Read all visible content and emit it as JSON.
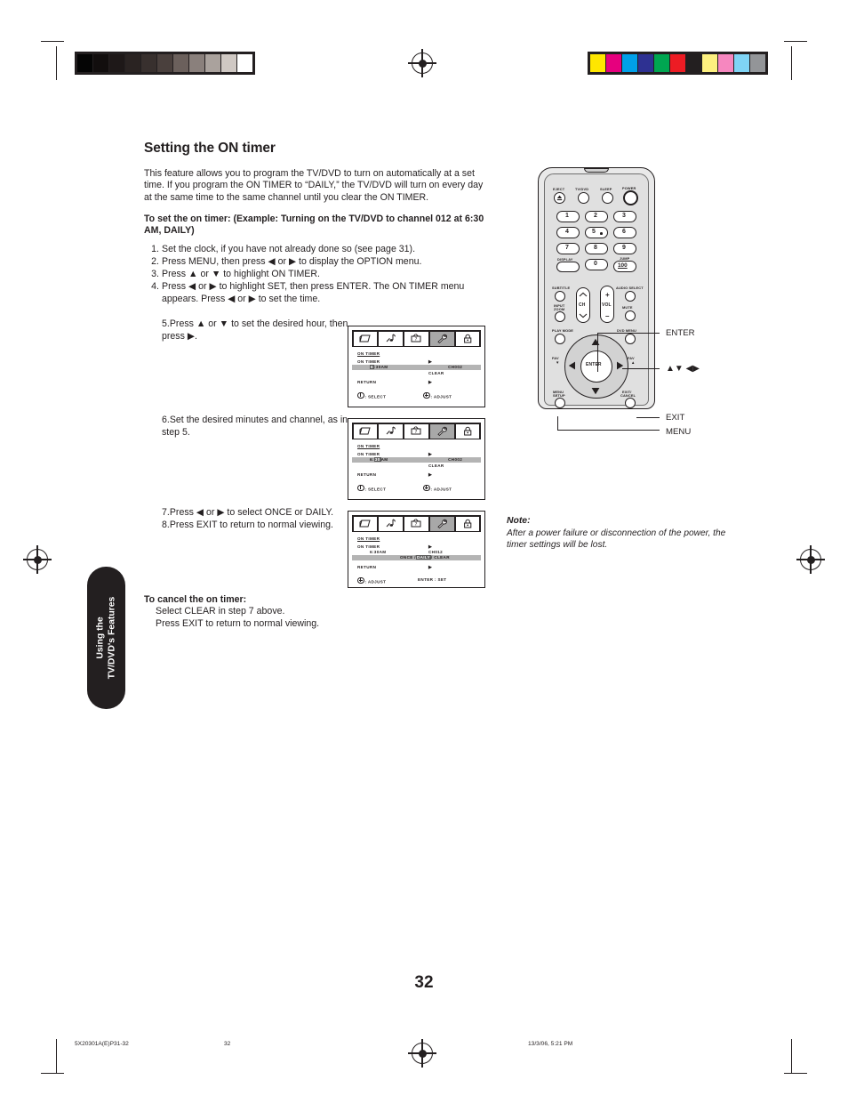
{
  "document": {
    "page_number": "32",
    "section_tab": "Using the\nTV/DVD's Features",
    "section_tab_line1": "Using the",
    "section_tab_line2": "TV/DVD's Features"
  },
  "content": {
    "title": "Setting the ON timer",
    "intro": "This feature allows you to program the TV/DVD to turn on automatically at a set time. If you program the ON TIMER to “DAILY,” the TV/DVD will turn on every day at the same time to the same channel until you clear the ON TIMER.",
    "subheading": "To set the on timer: (Example: Turning on the TV/DVD to channel 012 at 6:30 AM, DAILY)",
    "steps": [
      {
        "num": "1.",
        "text": "Set the clock, if you have not already done so (see page 31)."
      },
      {
        "num": "2.",
        "text": "Press MENU, then press ◀ or ▶ to display the OPTION menu."
      },
      {
        "num": "3.",
        "text": "Press ▲ or ▼ to highlight ON TIMER."
      },
      {
        "num": "4.",
        "text": "Press ◀ or ▶ to highlight SET, then press ENTER. The ON TIMER menu appears. Press ◀ or ▶ to set the time."
      },
      {
        "num": "5.",
        "text": "Press ▲ or ▼ to set the desired hour, then press ▶."
      },
      {
        "num": "6.",
        "text": "Set the desired minutes and channel, as in step 5."
      },
      {
        "num": "7.",
        "text": "Press ◀ or ▶ to select ONCE or DAILY."
      },
      {
        "num": "8.",
        "text": "Press EXIT to return to normal viewing."
      }
    ],
    "cancel": {
      "heading": "To cancel the on timer:",
      "line1": "Select CLEAR in step 7 above.",
      "line2": "Press EXIT to return to normal viewing."
    },
    "note": {
      "heading": "Note:",
      "body": "After a power failure or disconnection of the power, the timer settings will be lost."
    }
  },
  "osd_screens": [
    {
      "id": "osd-step5",
      "icons": [
        "picture-icon",
        "audio-icon",
        "tv-setup-icon",
        "wrench-icon",
        "lock-icon"
      ],
      "selected_icon_index": 3,
      "header": "ON TIMER",
      "label": "ON TIMER",
      "time": "6:30AM",
      "time_selected_part": "6",
      "time_rest": ":30AM",
      "channel": "CH002",
      "clear": "CLEAR",
      "return": "RETURN",
      "indicator": "▶",
      "footer_left": ": SELECT",
      "footer_right": ": ADJUST"
    },
    {
      "id": "osd-step6",
      "icons": [
        "picture-icon",
        "audio-icon",
        "tv-setup-icon",
        "wrench-icon",
        "lock-icon"
      ],
      "selected_icon_index": 3,
      "header": "ON TIMER",
      "label": "ON TIMER",
      "time": "6:30AM",
      "time_selected_part": "30",
      "time_rest": "AM",
      "time_prefix": "6:",
      "channel": "CH002",
      "clear": "CLEAR",
      "return": "RETURN",
      "indicator": "▶",
      "footer_left": ": SELECT",
      "footer_right": ": ADJUST"
    },
    {
      "id": "osd-step7",
      "icons": [
        "picture-icon",
        "audio-icon",
        "tv-setup-icon",
        "wrench-icon",
        "lock-icon"
      ],
      "selected_icon_index": 3,
      "header": "ON TIMER",
      "label": "ON TIMER",
      "time": "6:30AM",
      "channel": "CH012",
      "mode_once": "ONCE /",
      "mode_daily": "DAILY",
      "mode_clear": "/ CLEAR",
      "return": "RETURN",
      "indicator": "▶",
      "footer_left": ": ADJUST",
      "footer_right": "ENTER : SET"
    }
  ],
  "remote": {
    "buttons": [
      {
        "label": "EJECT",
        "name": "eject-button"
      },
      {
        "label": "TV/DVD",
        "name": "tv-dvd-button"
      },
      {
        "label": "SLEEP",
        "name": "sleep-button"
      },
      {
        "label": "POWER",
        "name": "power-button"
      },
      {
        "label": "1",
        "name": "digit-1-button"
      },
      {
        "label": "2",
        "name": "digit-2-button"
      },
      {
        "label": "3",
        "name": "digit-3-button"
      },
      {
        "label": "4",
        "name": "digit-4-button"
      },
      {
        "label": "5",
        "name": "digit-5-button"
      },
      {
        "label": "6",
        "name": "digit-6-button"
      },
      {
        "label": "7",
        "name": "digit-7-button"
      },
      {
        "label": "8",
        "name": "digit-8-button"
      },
      {
        "label": "9",
        "name": "digit-9-button"
      },
      {
        "label": "0",
        "name": "digit-0-button"
      },
      {
        "label": "DISPLAY",
        "name": "display-button"
      },
      {
        "label": "JUMP",
        "name": "jump-button"
      },
      {
        "label": "100",
        "name": "hundred-button"
      },
      {
        "label": "SUBTITLE",
        "name": "subtitle-button"
      },
      {
        "label": "AUDIO SELECT",
        "name": "audio-select-button"
      },
      {
        "label": "INPUT",
        "name": "input-zoom-button"
      },
      {
        "label": "ZOOM",
        "name": "input-zoom-button-2"
      },
      {
        "label": "CH",
        "name": "channel-rocker"
      },
      {
        "label": "VOL",
        "name": "volume-rocker"
      },
      {
        "label": "MUTE",
        "name": "mute-button"
      },
      {
        "label": "PLAY MODE",
        "name": "play-mode-button"
      },
      {
        "label": "DVD MENU",
        "name": "dvd-menu-button"
      },
      {
        "label": "ENTER",
        "name": "enter-button"
      },
      {
        "label": "FAV",
        "name": "fav-down-button"
      },
      {
        "label": "FAV",
        "name": "fav-up-button"
      },
      {
        "label": "MENU",
        "name": "menu-setup-button"
      },
      {
        "label": "SETUP",
        "name": "menu-setup-button-2"
      },
      {
        "label": "EXIT/",
        "name": "exit-cancel-button"
      },
      {
        "label": "CANCEL",
        "name": "exit-cancel-button-2"
      }
    ],
    "labels": {
      "eject": "EJECT",
      "tvdvd": "TV/DVD",
      "sleep": "SLEEP",
      "power": "POWER",
      "display": "DISPLAY",
      "jump": "JUMP",
      "hundred": "100",
      "subtitle": "SUBTITLE",
      "audio_select": "AUDIO SELECT",
      "input": "INPUT",
      "zoom": "ZOOM",
      "ch": "CH",
      "vol": "VOL",
      "vol_plus": "+",
      "vol_minus": "–",
      "mute": "MUTE",
      "play_mode": "PLAY MODE",
      "dvd_menu": "DVD MENU",
      "enter": "ENTER",
      "fav_down": "FAV",
      "fav_up": "FAV",
      "menu": "MENU",
      "setup": "SETUP",
      "exit": "EXIT/",
      "cancel": "CANCEL"
    },
    "digits": [
      "1",
      "2",
      "3",
      "4",
      "5",
      "6",
      "7",
      "8",
      "9",
      "0"
    ],
    "callouts": [
      {
        "text": "ENTER",
        "name": "callout-enter"
      },
      {
        "text": "▲▼ ◀▶",
        "name": "callout-arrows"
      },
      {
        "text": "EXIT",
        "name": "callout-exit"
      },
      {
        "text": "MENU",
        "name": "callout-menu"
      }
    ]
  },
  "print_marks": {
    "gray_swatches": [
      "#050505",
      "#120e0e",
      "#1e1818",
      "#2a2322",
      "#38302e",
      "#4a403d",
      "#6b605c",
      "#8a807c",
      "#aaa29d",
      "#cfc8c3",
      "#ffffff"
    ],
    "color_swatches": [
      "#ffe600",
      "#e6007e",
      "#00a0e9",
      "#2e3192",
      "#00a651",
      "#ed1c24",
      "#231f20",
      "#fdf07f",
      "#f687bf",
      "#7fd4f5",
      "#939598"
    ]
  },
  "footer": {
    "job": "5X20301A(E)P31-32",
    "page": "32",
    "datetime": "13/3/06, 5:21 PM"
  }
}
